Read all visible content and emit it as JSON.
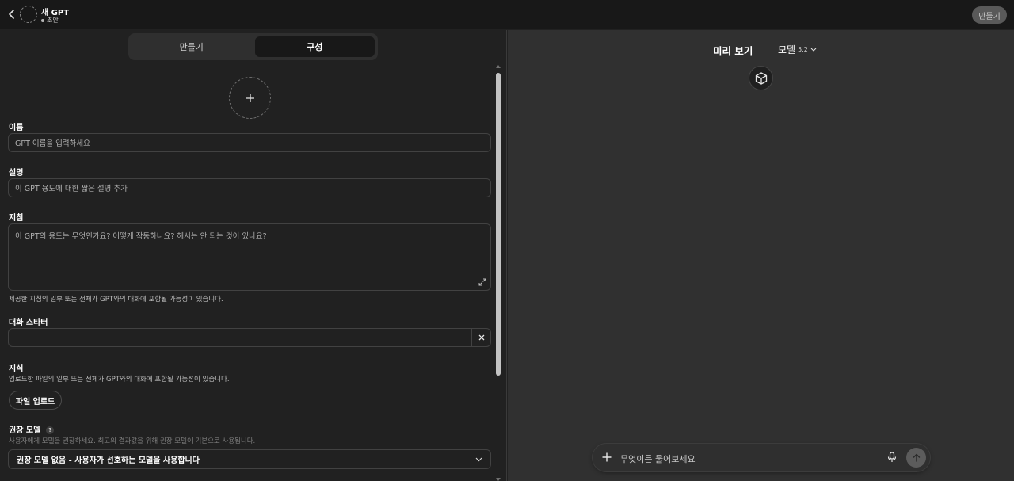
{
  "header": {
    "gpt_name": "새 GPT",
    "status": "초안",
    "create_button": "만들기"
  },
  "tabs": [
    {
      "label": "만들기",
      "active": false
    },
    {
      "label": "구성",
      "active": true
    }
  ],
  "form": {
    "name": {
      "label": "이름",
      "placeholder": "GPT 이름을 입력하세요"
    },
    "description": {
      "label": "설명",
      "placeholder": "이 GPT 용도에 대한 짧은 설명 추가"
    },
    "instructions": {
      "label": "지침",
      "placeholder": "이 GPT의 용도는 무엇인가요? 어떻게 작동하나요? 해서는 안 되는 것이 있나요?",
      "hint": "제공한 지침의 일부 또는 전체가 GPT와의 대화에 포함될 가능성이 있습니다."
    },
    "starters": {
      "label": "대화 스타터"
    },
    "knowledge": {
      "label": "지식",
      "hint": "업로드한 파일의 일부 또는 전체가 GPT와의 대화에 포함될 가능성이 있습니다.",
      "upload_button": "파일 업로드"
    },
    "recommended_model": {
      "label": "권장 모델",
      "hint": "사용자에게 모델을 권장하세요. 최고의 결과값을 위해 권장 모델이 기본으로 사용됩니다.",
      "selected": "권장 모델 없음 - 사용자가 선호하는 모델을 사용합니다"
    }
  },
  "preview": {
    "title": "미리 보기",
    "model_label": "모델",
    "model_version": "5.2",
    "composer_placeholder": "무엇이든 물어보세요"
  },
  "icons": [
    "chevron-left-icon",
    "plus-icon",
    "expand-icon",
    "close-icon",
    "help-icon",
    "chevron-down-icon",
    "cube-icon",
    "mic-icon",
    "arrow-up-icon"
  ]
}
